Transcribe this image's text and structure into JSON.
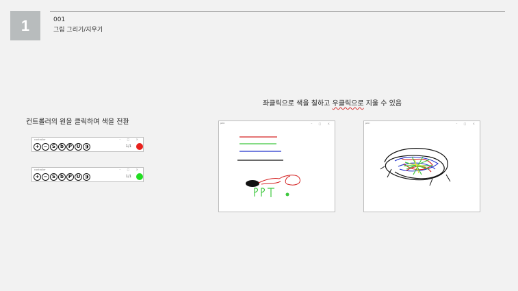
{
  "slide": {
    "number": "1",
    "code": "001",
    "subtitle": "그림 그리기/지우기"
  },
  "captions": {
    "right_before": "좌클릭으로 색을 칠하고 ",
    "right_underlined": "우클릭으로",
    "right_after": " 지울 수 있음",
    "left": "컨트롤러의 원을 클릭하여 색을 전환"
  },
  "controller": {
    "title": "controller",
    "window_buttons": "– □ ×",
    "buttons": [
      {
        "glyph": "+",
        "icon": "plus-icon"
      },
      {
        "glyph": "−",
        "icon": "minus-icon"
      },
      {
        "glyph": "S",
        "icon": "save-icon"
      },
      {
        "glyph": "b",
        "icon": "back-icon"
      },
      {
        "glyph": "P",
        "icon": "pen-icon"
      },
      {
        "glyph": "U",
        "icon": "undo-icon"
      },
      {
        "glyph": "◑",
        "icon": "eraser-icon"
      }
    ],
    "page_indicator": "1/1",
    "instances": [
      {
        "active_color": "#e8211c"
      },
      {
        "active_color": "#22dd22"
      }
    ]
  },
  "canvas_windows": {
    "title": "pen",
    "window_buttons": "– □ ×",
    "drawn_text": "PPT",
    "colors": {
      "red": "#d42020",
      "green": "#3ec83e",
      "blue": "#2233cc",
      "black": "#111111"
    }
  }
}
